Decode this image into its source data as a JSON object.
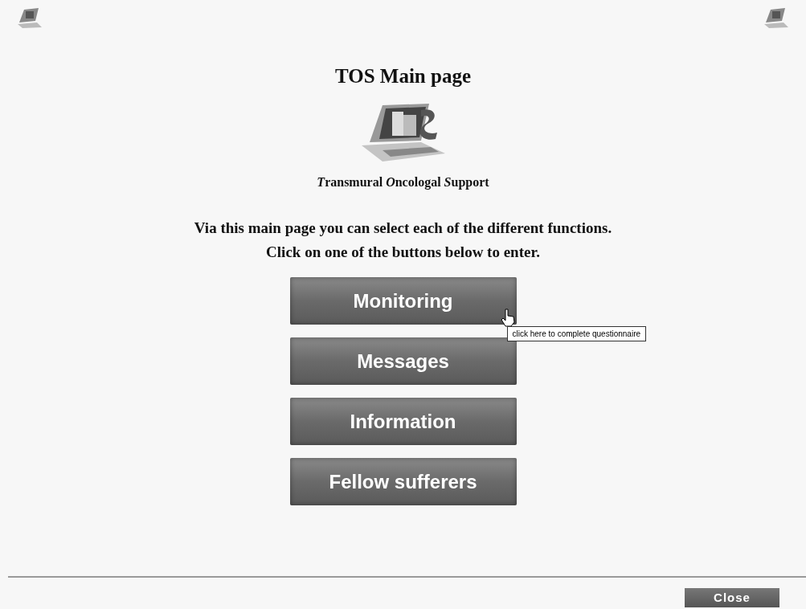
{
  "title": "TOS Main page",
  "subtitle": [
    {
      "initial": "T",
      "rest": "ransmural"
    },
    {
      "initial": "O",
      "rest": "ncologal"
    },
    {
      "initial": "S",
      "rest": "upport"
    }
  ],
  "intro": [
    "Via this main page you can select each of the different functions.",
    "Click on one of the buttons below to enter."
  ],
  "buttons": [
    {
      "label": "Monitoring",
      "hovered": true,
      "tooltip": "click here to complete questionnaire"
    },
    {
      "label": "Messages",
      "hovered": false
    },
    {
      "label": "Information",
      "hovered": false
    },
    {
      "label": "Fellow sufferers",
      "hovered": false
    }
  ],
  "close_button": "Close"
}
